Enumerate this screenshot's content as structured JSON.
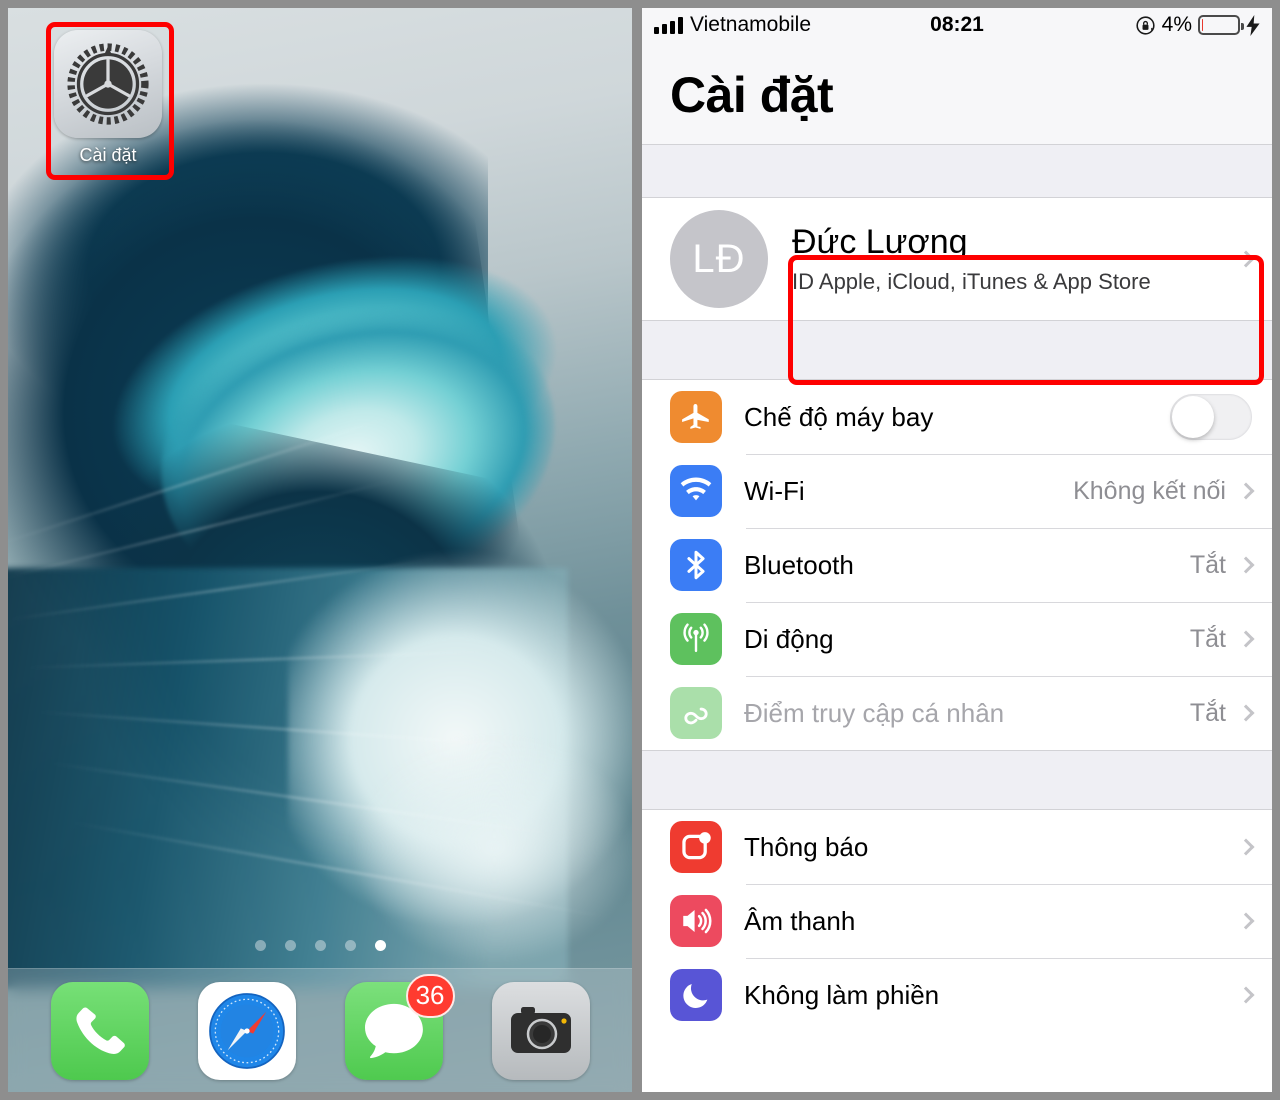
{
  "home": {
    "app": {
      "label": "Cài đặt",
      "icon": "settings-gear-icon"
    },
    "page_dots": {
      "count": 5,
      "active_index": 5
    },
    "dock": [
      {
        "name": "phone-app-icon",
        "label": "Phone",
        "color": "#5fd35f",
        "badge": null
      },
      {
        "name": "safari-app-icon",
        "label": "Safari",
        "color": "#ffffff",
        "badge": null
      },
      {
        "name": "messages-app-icon",
        "label": "Messages",
        "color": "#5fd35f",
        "badge": "36"
      },
      {
        "name": "camera-app-icon",
        "label": "Camera",
        "color": "#c9ccce",
        "badge": null
      }
    ]
  },
  "settings": {
    "statusbar": {
      "carrier": "Vietnamobile",
      "time": "08:21",
      "battery_percent": "4%",
      "battery_level": 4,
      "signal_bars": 4,
      "rotation_lock": "rotation-lock-icon",
      "charging": "charging-bolt-icon"
    },
    "title": "Cài đặt",
    "account": {
      "initials": "LĐ",
      "name": "Đức Lương",
      "subtitle": "ID Apple, iCloud, iTunes & App Store"
    },
    "group_connectivity": [
      {
        "icon": "airplane-icon",
        "color": "#ef8b30",
        "label": "Chế độ máy bay",
        "control": "toggle",
        "toggle_on": false,
        "value": "",
        "dim": false
      },
      {
        "icon": "wifi-icon",
        "color": "#3b7df5",
        "label": "Wi-Fi",
        "control": "chevron",
        "value": "Không kết nối",
        "dim": false
      },
      {
        "icon": "bluetooth-icon",
        "color": "#3b7df5",
        "label": "Bluetooth",
        "control": "chevron",
        "value": "Tắt",
        "dim": false
      },
      {
        "icon": "cellular-icon",
        "color": "#5ec15e",
        "label": "Di động",
        "control": "chevron",
        "value": "Tắt",
        "dim": false
      },
      {
        "icon": "hotspot-icon",
        "color": "#aadfaa",
        "label": "Điểm truy cập cá nhân",
        "control": "chevron",
        "value": "Tắt",
        "dim": true
      }
    ],
    "group_alerts": [
      {
        "icon": "notifications-icon",
        "color": "#ef3b30",
        "label": "Thông báo",
        "control": "chevron",
        "value": "",
        "dim": false
      },
      {
        "icon": "sounds-icon",
        "color": "#ed4a5f",
        "label": "Âm thanh",
        "control": "chevron",
        "value": "",
        "dim": false
      },
      {
        "icon": "moon-icon",
        "color": "#5855d6",
        "label": "Không làm phiền",
        "control": "chevron",
        "value": "",
        "dim": false
      }
    ]
  },
  "annotations": {
    "accent_color": "#fe0000",
    "boxes": [
      {
        "name": "settings-app-highlight",
        "target": "Cài đặt app icon"
      },
      {
        "name": "apple-id-row-highlight",
        "target": "Đức Lương account row"
      }
    ]
  }
}
